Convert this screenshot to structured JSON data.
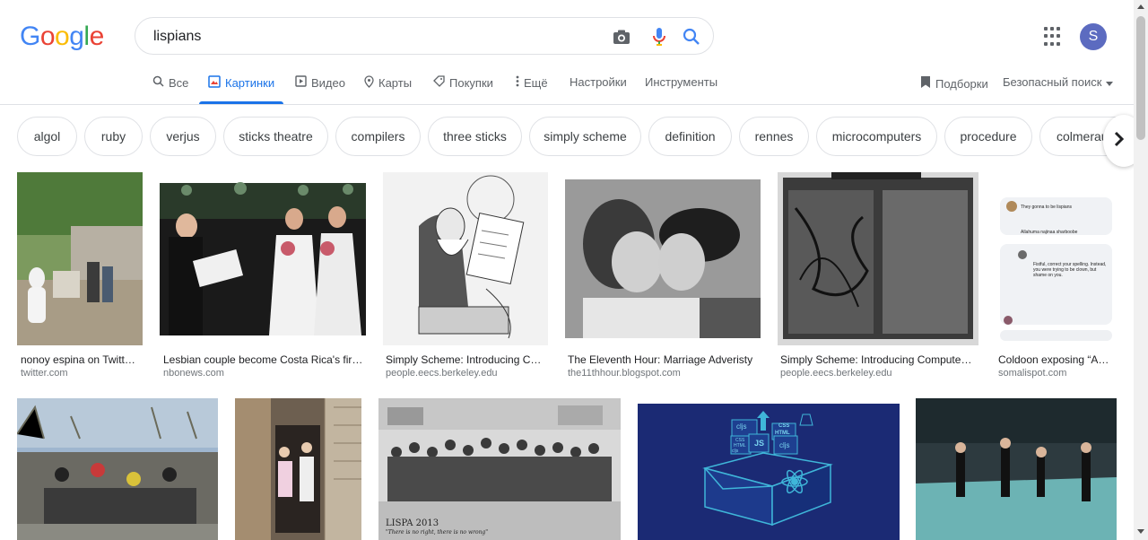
{
  "logo": "Google",
  "search": {
    "value": "lispians"
  },
  "user": {
    "initial": "S"
  },
  "tabs": [
    {
      "label": "Все"
    },
    {
      "label": "Картинки"
    },
    {
      "label": "Видео"
    },
    {
      "label": "Карты"
    },
    {
      "label": "Покупки"
    },
    {
      "label": "Ещё"
    },
    {
      "label": "Настройки"
    },
    {
      "label": "Инструменты"
    }
  ],
  "right_tools": {
    "collections": "Подборки",
    "safe_search": "Безопасный поиск"
  },
  "chips": [
    "algol",
    "ruby",
    "verjus",
    "sticks theatre",
    "compilers",
    "three sticks",
    "simply scheme",
    "definition",
    "rennes",
    "microcomputers",
    "procedure",
    "colmerau"
  ],
  "results_row1": [
    {
      "caption": "nonoy espina on Twitte…",
      "source": "twitter.com"
    },
    {
      "caption": "Lesbian couple become Costa Rica's first…",
      "source": "nbonews.com"
    },
    {
      "caption": "Simply Scheme: Introducing Co…",
      "source": "people.eecs.berkeley.edu"
    },
    {
      "caption": "The Eleventh Hour: Marriage Adveristy",
      "source": "the11thhour.blogspot.com"
    },
    {
      "caption": "Simply Scheme: Introducing Computer …",
      "source": "people.eecs.berkeley.edu"
    },
    {
      "caption": "Coldoon exposing “Ab…",
      "source": "somalispot.com"
    }
  ],
  "image_text": {
    "lispa": "LISPA 2013",
    "lispa_sub": "\"There is no right, there is no wrong\"",
    "cljs1": "cljs",
    "css1": "CSS",
    "html1": "HTML",
    "js": "JS",
    "cljs2": "cljs",
    "css2": "CSS",
    "html2": "HTML",
    "cljs3": "cljs",
    "fb_text1": "They gonna to be lispians",
    "fb_text2": "Allahuma najinaa sharboobe",
    "fb_text3": "Fistful, correct your spelling. Instead, you were trying to be clown, but shame on you."
  },
  "colors": {
    "accent": "#1a73e8",
    "chip_border": "#dfe1e5"
  }
}
